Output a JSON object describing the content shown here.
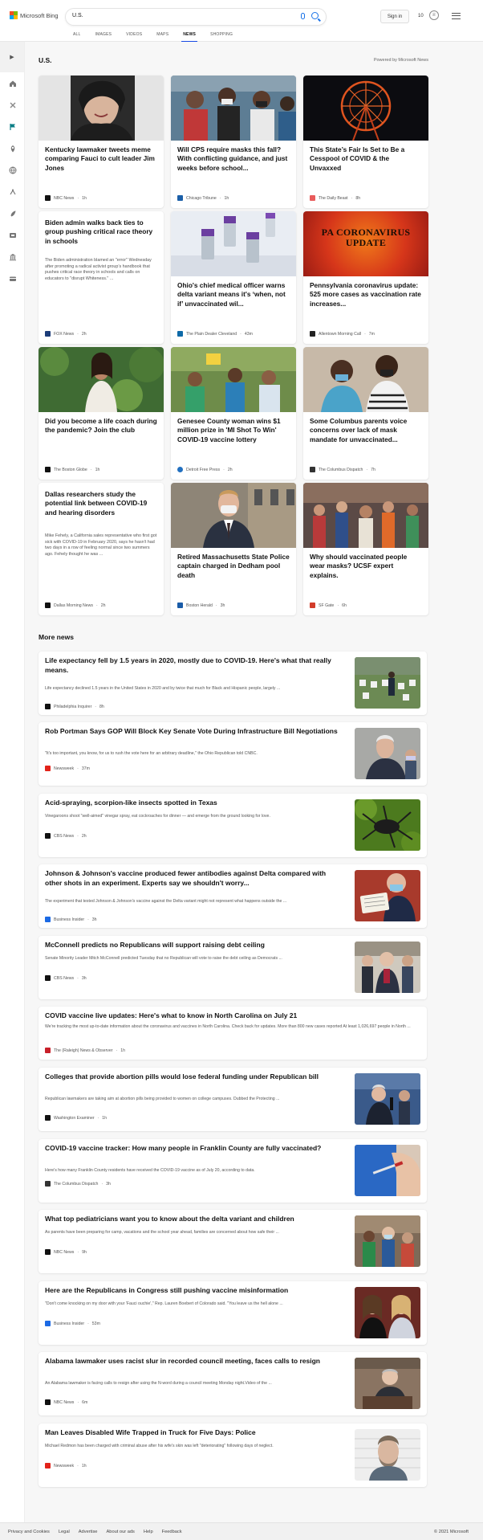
{
  "header": {
    "logo_text": "Microsoft Bing",
    "search_value": "U.S.",
    "signin_label": "Sign in",
    "rewards_count": "10",
    "tabs": [
      {
        "label": "ALL"
      },
      {
        "label": "IMAGES"
      },
      {
        "label": "VIDEOS"
      },
      {
        "label": "MAPS"
      },
      {
        "label": "NEWS"
      },
      {
        "label": "SHOPPING"
      }
    ],
    "active_tab": "NEWS"
  },
  "sidebar": {
    "icons": [
      "expand-icon",
      "home-icon",
      "tools-icon",
      "flag-icon",
      "location-icon",
      "globe-icon",
      "briefcase-icon",
      "rocket-icon",
      "movie-icon",
      "bank-icon",
      "card-icon"
    ]
  },
  "section": {
    "title": "U.S.",
    "powered_by": "Powered by Microsoft News"
  },
  "cards": [
    {
      "title": "Kentucky lawmaker tweets meme comparing Fauci to cult leader Jim Jones",
      "publisher": "NBC News",
      "time": "1h",
      "icon_color": "#111111"
    },
    {
      "title": "Will CPS require masks this fall? With conflicting guidance, and just weeks before school...",
      "publisher": "Chicago Tribune",
      "time": "1h",
      "icon_color": "#1b5fa8"
    },
    {
      "title": "This State’s Fair Is Set to Be a Cesspool of COVID & the Unvaxxed",
      "publisher": "The Daily Beast",
      "time": "8h",
      "icon_color": "#e95b5b"
    },
    {
      "title": "Biden admin walks back ties to group pushing critical race theory in schools",
      "snippet": "The Biden administration blamed an \"error\" Wednesday after promoting a radical activist group’s handbook that pushes critical race theory in schools and calls on educators to \"disrupt Whiteness.\" ...",
      "publisher": "FOX News",
      "time": "2h",
      "icon_color": "#1c3c78"
    },
    {
      "title": "Ohio's chief medical officer warns delta variant means it's ‘when, not if’ unvaccinated wil...",
      "publisher": "The Plain Dealer Cleveland",
      "time": "43m",
      "icon_color": "#0e6aa8"
    },
    {
      "title": "Pennsylvania coronavirus update: 525 more cases as vaccination rate increases...",
      "publisher": "Allentown Morning Call",
      "time": "7m",
      "icon_color": "#222222",
      "image_text": "PA CORONAVIRUS UPDATE"
    },
    {
      "title": "Did you become a life coach during the pandemic? Join the club",
      "publisher": "The Boston Globe",
      "time": "1h",
      "icon_color": "#111111"
    },
    {
      "title": "Genesee County woman wins $1 million prize in 'MI Shot To Win' COVID-19 vaccine lottery",
      "publisher": "Detroit Free Press",
      "time": "2h",
      "icon_color": "#2270c0"
    },
    {
      "title": "Some Columbus parents voice concerns over lack of mask mandate for unvaccinated...",
      "publisher": "The Columbus Dispatch",
      "time": "7h",
      "icon_color": "#333333"
    },
    {
      "title": "Dallas researchers study the potential link between COVID-19 and hearing disorders",
      "snippet": "Mike Fehely, a California sales representative who first got sick with COVID-19 in February 2020, says he hasn't had two days in a row of feeling normal since two summers ago. Fehely thought he was ...",
      "publisher": "Dallas Morning News",
      "time": "2h",
      "icon_color": "#111111"
    },
    {
      "title": "Retired Massachusetts State Police captain charged in Dedham pool death",
      "publisher": "Boston Herald",
      "time": "3h",
      "icon_color": "#1a5ca8"
    },
    {
      "title": "Why should vaccinated people wear masks? UCSF expert explains.",
      "publisher": "SF Gate",
      "time": "6h",
      "icon_color": "#d23c2a"
    }
  ],
  "more_news": {
    "title": "More news",
    "items": [
      {
        "title": "Life expectancy fell by 1.5 years in 2020, mostly due to COVID-19. Here's what that really means.",
        "snippet": "Life expectancy declined 1.5 years in the United States in 2020 and by twice that much for Black and Hispanic people, largely ...",
        "publisher": "Philadelphia Inquirer",
        "time": "8h",
        "icon_color": "#111111"
      },
      {
        "title": "Rob Portman Says GOP Will Block Key Senate Vote During Infrastructure Bill Negotiations",
        "snippet": "\"It's too important, you know, for us to rush the vote here for an arbitrary deadline,\" the Ohio Republican told CNBC.",
        "publisher": "Newsweek",
        "time": "37m",
        "icon_color": "#e2231a"
      },
      {
        "title": "Acid-spraying, scorpion-like insects spotted in Texas",
        "snippet": "Vinegaroons shoot \"well-aimed\" vinegar spray, eat cockroaches for dinner — and emerge from the ground looking for love.",
        "publisher": "CBS News",
        "time": "2h",
        "icon_color": "#111111"
      },
      {
        "title": "Johnson & Johnson's vaccine produced fewer antibodies against Delta compared with other shots in an experiment. Experts say we shouldn't worry...",
        "snippet": "The experiment that tested Johnson & Johnson's vaccine against the Delta variant might not represent what happens outside the ...",
        "publisher": "Business Insider",
        "time": "3h",
        "icon_color": "#1c6ae4"
      },
      {
        "title": "McConnell predicts no Republicans will support raising debt ceiling",
        "snippet": "Senate Minority Leader Mitch McConnell predicted Tuesday that no Republican will vote to raise the debt ceiling as Democrats ...",
        "publisher": "CBS News",
        "time": "3h",
        "icon_color": "#111111"
      },
      {
        "title": "COVID vaccine live updates: Here's what to know in North Carolina on July 21",
        "snippet": "We're tracking the most up-to-date information about the coronavirus and vaccines in North Carolina. Check back for updates. More than 800 new cases reported At least 1,026,697 people in North ...",
        "publisher": "The (Raleigh) News & Observer",
        "time": "1h",
        "icon_color": "#c8202a"
      },
      {
        "title": "Colleges that provide abortion pills would lose federal funding under Republican bill",
        "snippet": "Republican lawmakers are taking aim at abortion pills being provided to women on college campuses. Dubbed the Protecting ...",
        "publisher": "Washington Examiner",
        "time": "1h",
        "icon_color": "#111111"
      },
      {
        "title": "COVID-19 vaccine tracker: How many people in Franklin County are fully vaccinated?",
        "snippet": "Here's how many Franklin County residents have received the COVID-19 vaccine as of July 20, according to data.",
        "publisher": "The Columbus Dispatch",
        "time": "3h",
        "icon_color": "#333333"
      },
      {
        "title": "What top pediatricians want you to know about the delta variant and children",
        "snippet": "As parents have been preparing for camp, vacations and the school year ahead, families are concerned about how safe their ...",
        "publisher": "NBC News",
        "time": "9h",
        "icon_color": "#111111"
      },
      {
        "title": "Here are the Republicans in Congress still pushing vaccine misinformation",
        "snippet": "\"Don't come knocking on my door with your 'Fauci ouchie',\" Rep. Lauren Boebert of Colorado said. \"You leave us the hell alone ...",
        "publisher": "Business Insider",
        "time": "53m",
        "icon_color": "#1c6ae4"
      },
      {
        "title": "Alabama lawmaker uses racist slur in recorded council meeting, faces calls to resign",
        "snippet": "An Alabama lawmaker is facing calls to resign after using the N-word during a council meeting Monday night.Video of the ...",
        "publisher": "NBC News",
        "time": "6m",
        "icon_color": "#111111"
      },
      {
        "title": "Man Leaves Disabled Wife Trapped in Truck for Five Days: Police",
        "snippet": "Michael Redmon has been charged with criminal abuse after his wife's skin was left \"deteriorating\" following days of neglect.",
        "publisher": "Newsweek",
        "time": "1h",
        "icon_color": "#e2231a"
      }
    ]
  },
  "footer": {
    "links": [
      "Privacy and Cookies",
      "Legal",
      "Advertise",
      "About our ads",
      "Help",
      "Feedback"
    ],
    "copyright": "© 2021 Microsoft"
  }
}
